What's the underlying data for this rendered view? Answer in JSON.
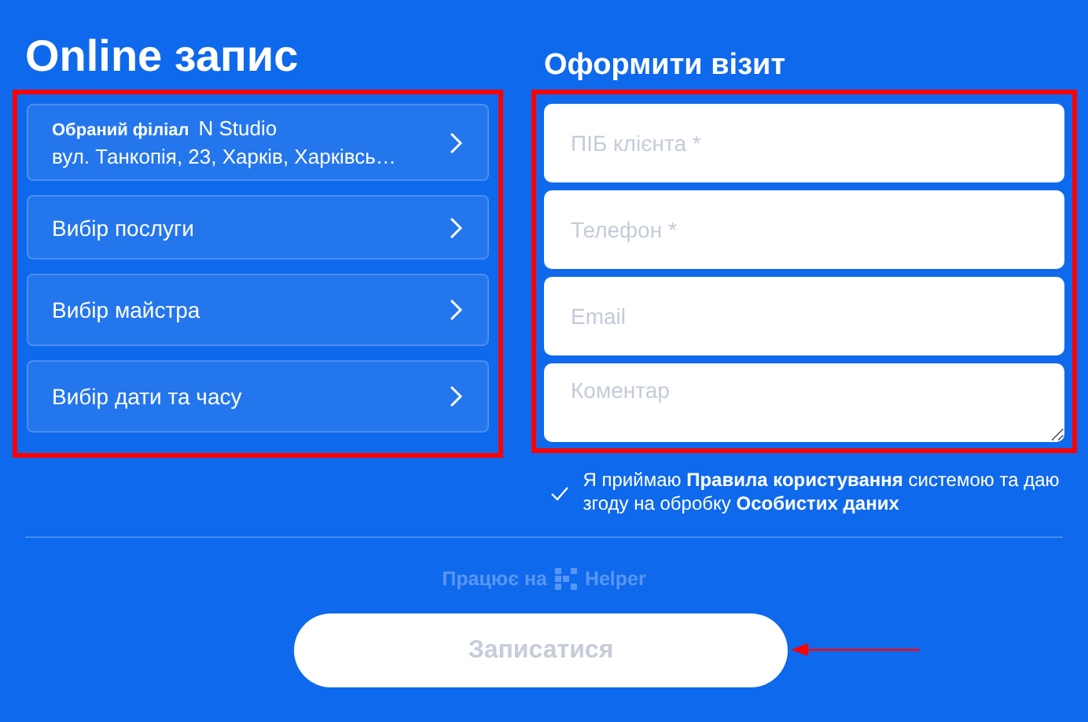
{
  "booking": {
    "title": "Online запис",
    "highlighted": true,
    "steps": [
      {
        "kind": "branch",
        "label": "Обраний філіал",
        "value": "N Studio",
        "address": "вул. Танкопія, 23, Харків, Харківсь…"
      },
      {
        "kind": "choice",
        "label": "Вибір послуги"
      },
      {
        "kind": "choice",
        "label": "Вибір майстра"
      },
      {
        "kind": "choice",
        "label": "Вибір дати та часу"
      }
    ]
  },
  "visit_form": {
    "title": "Оформити візит",
    "highlighted": true,
    "fields": [
      {
        "kind": "input",
        "placeholder": "ПІБ клієнта *"
      },
      {
        "kind": "input",
        "placeholder": "Телефон *"
      },
      {
        "kind": "input",
        "placeholder": "Email"
      },
      {
        "kind": "textarea",
        "placeholder": "Коментар"
      }
    ],
    "consent": {
      "checked": true,
      "text": "Я приймаю **Правила користування** системою та даю згоду на обробку **Особистих даних**"
    }
  },
  "powered_by": {
    "prefix": "Працює на",
    "brand": "Helper"
  },
  "submit_button": {
    "label": "Записатися",
    "disabled": true,
    "annotation_arrow": true
  }
}
